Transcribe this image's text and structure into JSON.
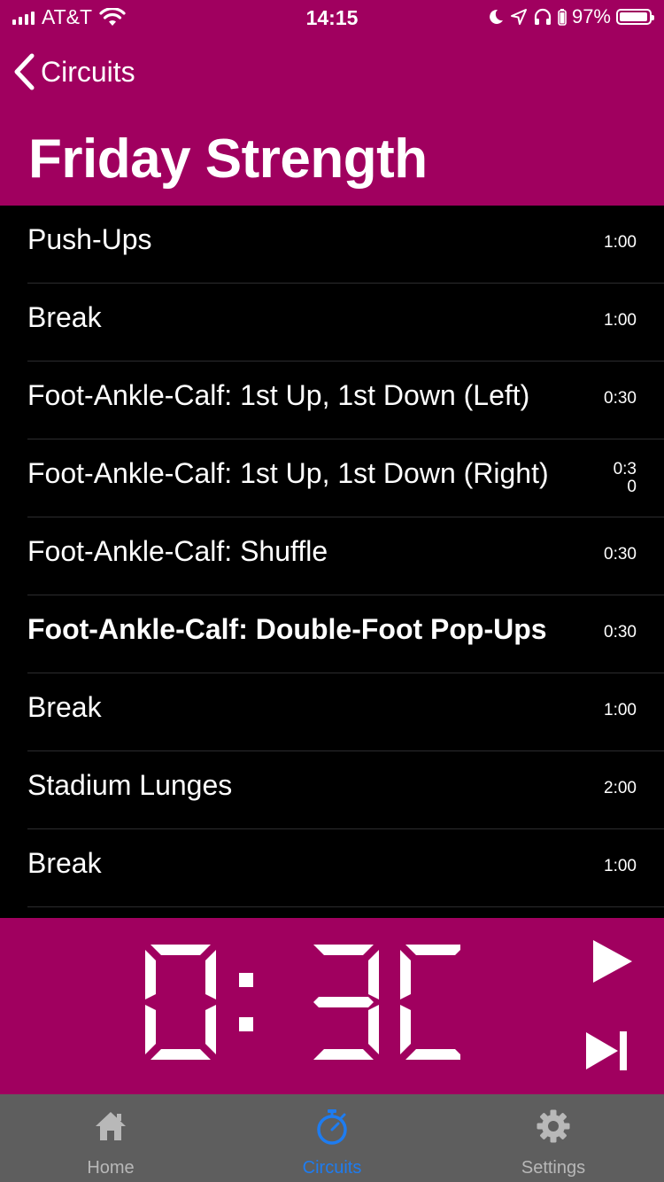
{
  "status_bar": {
    "carrier": "AT&T",
    "time": "14:15",
    "battery": "97%",
    "battery_level": 0.97
  },
  "nav": {
    "back_label": "Circuits",
    "title": "Friday Strength"
  },
  "exercises": [
    {
      "name": "Push-Ups",
      "duration": "1:00",
      "bold": false
    },
    {
      "name": "Break",
      "duration": "1:00",
      "bold": false
    },
    {
      "name": "Foot-Ankle-Calf: 1st Up, 1st Down (Left)",
      "duration": "0:30",
      "bold": false
    },
    {
      "name": "Foot-Ankle-Calf: 1st Up, 1st Down (Right)",
      "duration": "0:30",
      "bold": false
    },
    {
      "name": "Foot-Ankle-Calf: Shuffle",
      "duration": "0:30",
      "bold": false
    },
    {
      "name": "Foot-Ankle-Calf: Double-Foot Pop-Ups",
      "duration": "0:30",
      "bold": true
    },
    {
      "name": "Break",
      "duration": "1:00",
      "bold": false
    },
    {
      "name": "Stadium Lunges",
      "duration": "2:00",
      "bold": false
    },
    {
      "name": "Break",
      "duration": "1:00",
      "bold": false
    }
  ],
  "timer": {
    "display": "0:30",
    "play_icon": "play-icon",
    "skip_icon": "skip-forward-icon"
  },
  "tabs": [
    {
      "label": "Home",
      "icon": "home-icon",
      "active": false
    },
    {
      "label": "Circuits",
      "icon": "stopwatch-icon",
      "active": true
    },
    {
      "label": "Settings",
      "icon": "gear-icon",
      "active": false
    }
  ],
  "colors": {
    "brand": "#a0005f",
    "active_tab": "#1e7cf0",
    "tabbar": "#5e5e5e",
    "background": "#000000"
  }
}
